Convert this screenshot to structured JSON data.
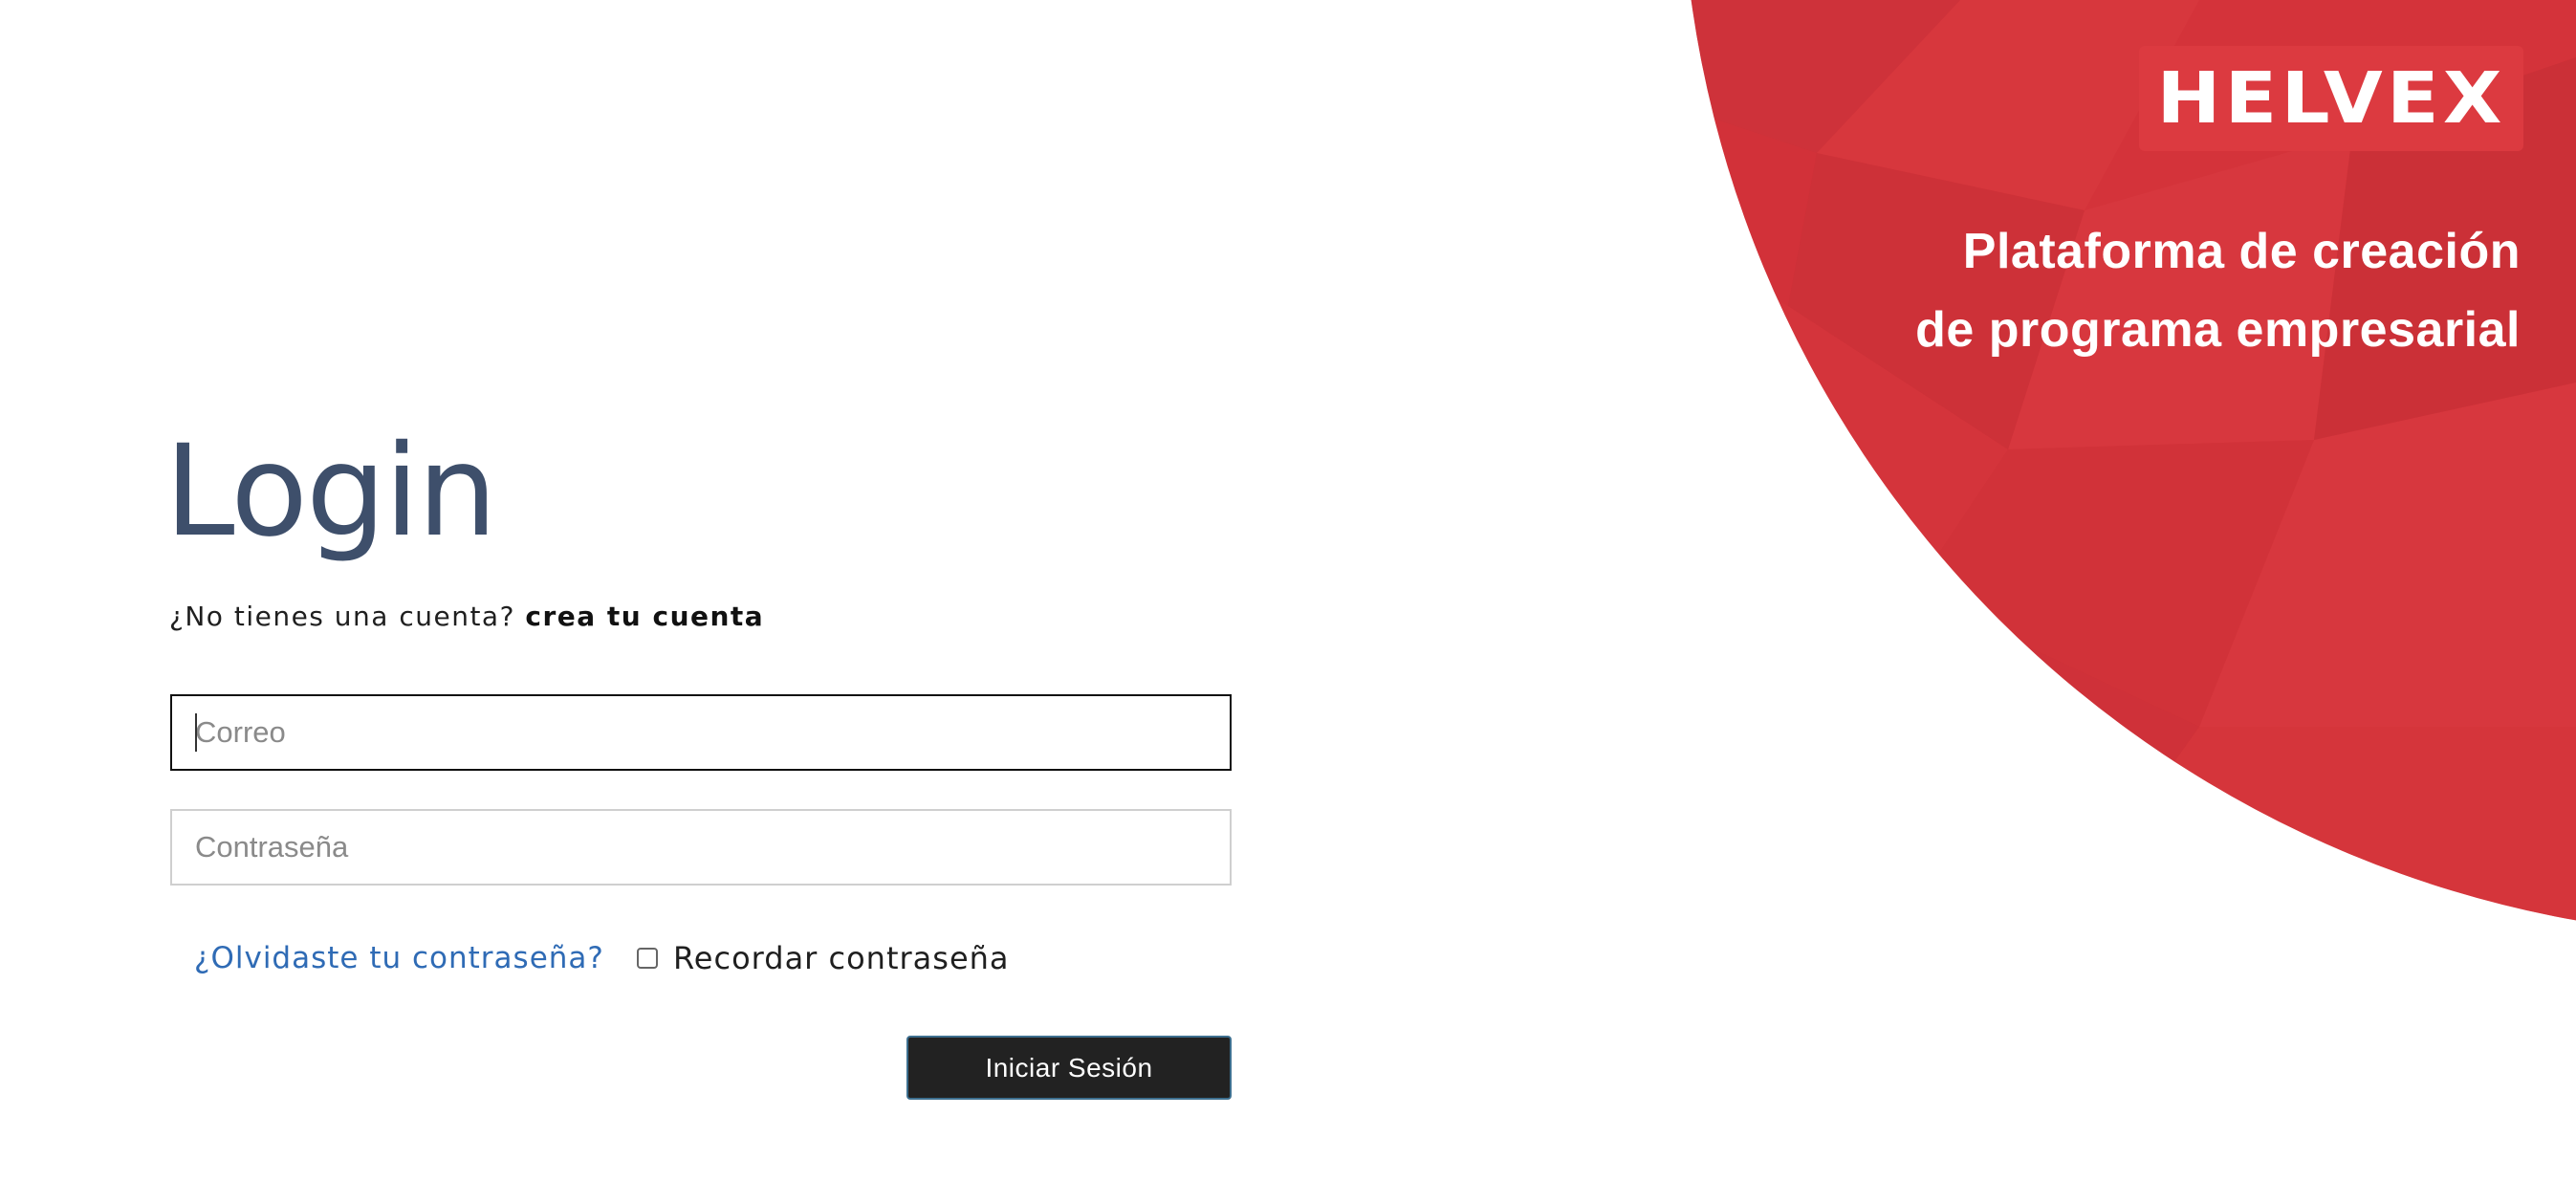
{
  "brand": {
    "logo_text": "HELVEX",
    "tagline_line1": "Plataforma de creación",
    "tagline_line2": "de programa empresarial",
    "accent_color": "#d4333a"
  },
  "login": {
    "title": "Login",
    "no_account_text": "¿No tienes una cuenta?",
    "create_account_link": "crea tu cuenta",
    "email_placeholder": "Correo",
    "password_placeholder": "Contraseña",
    "forgot_password_link": "¿Olvidaste tu contraseña?",
    "remember_label": "Recordar contraseña",
    "remember_checked": false,
    "submit_label": "Iniciar Sesión"
  }
}
